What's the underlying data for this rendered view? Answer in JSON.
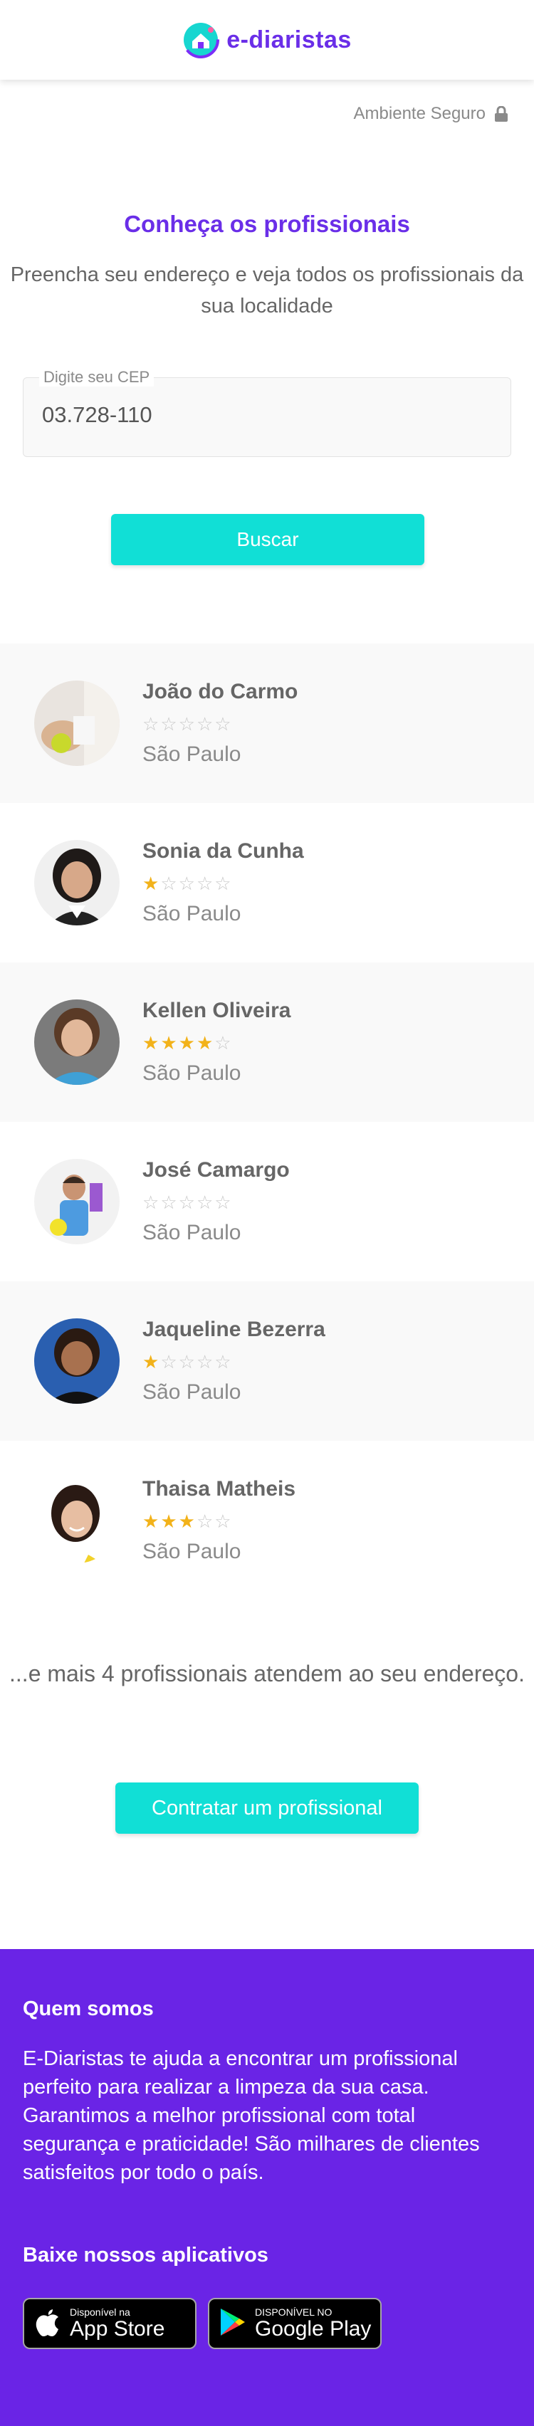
{
  "header": {
    "brand": "e-diaristas"
  },
  "security": {
    "label": "Ambiente Seguro",
    "icon": "lock-icon"
  },
  "search": {
    "title": "Conheça os profissionais",
    "subtitle": "Preencha seu endereço e veja todos os profissionais da sua localidade",
    "cep_label": "Digite seu CEP",
    "cep_value": "03.728-110",
    "button": "Buscar"
  },
  "professionals": [
    {
      "name": "João do Carmo",
      "rating": 0,
      "city": "São Paulo"
    },
    {
      "name": "Sonia da Cunha",
      "rating": 1,
      "city": "São Paulo"
    },
    {
      "name": "Kellen Oliveira",
      "rating": 4,
      "city": "São Paulo"
    },
    {
      "name": "José Camargo",
      "rating": 0,
      "city": "São Paulo"
    },
    {
      "name": "Jaqueline Bezerra",
      "rating": 1,
      "city": "São Paulo"
    },
    {
      "name": "Thaisa Matheis",
      "rating": 3,
      "city": "São Paulo"
    }
  ],
  "more_text": "...e mais 4 profissionais atendem ao seu endereço.",
  "hire_button": "Contratar um profissional",
  "footer": {
    "about_title": "Quem somos",
    "about_text": "E-Diaristas te ajuda a encontrar um profissional perfeito para realizar a limpeza da sua casa. Garantimos a melhor profissional com total segurança e praticidade! São milhares de clientes satisfeitos por todo o país.",
    "apps_title": "Baixe nossos aplicativos",
    "appstore_small": "Disponível na",
    "appstore_big": "App Store",
    "googleplay_small": "DISPONÍVEL NO",
    "googleplay_big": "Google Play"
  },
  "colors": {
    "brand": "#6a2ee8",
    "accent": "#11dfd6",
    "star": "#f2b21a",
    "footer": "#6a24e6"
  }
}
